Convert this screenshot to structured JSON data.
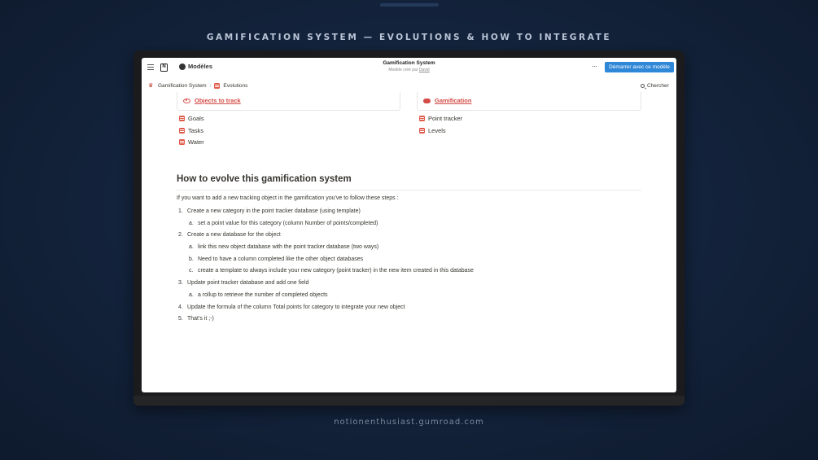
{
  "headline": "GAMIFICATION SYSTEM — EVOLUTIONS & HOW TO INTEGRATE",
  "footer": "notionenthusiast.gumroad.com",
  "topbar": {
    "templates_label": "Modèles",
    "page_title": "Gamification System",
    "subtitle_prefix": "Modèle créé par",
    "author": "David",
    "more_label": "···",
    "start_button": "Démarrer avec ce modèle"
  },
  "breadcrumb": {
    "root": "Gamification System",
    "separator": "/",
    "current": "Evolutions"
  },
  "search_label": "Chercher",
  "cards": {
    "left": {
      "title": "Objects to track",
      "icon": "eye-icon",
      "items": [
        "Goals",
        "Tasks",
        "Water"
      ]
    },
    "right": {
      "title": "Gamification",
      "icon": "gamepad-icon",
      "items": [
        "Point tracker",
        "Levels"
      ]
    }
  },
  "section": {
    "heading": "How to evolve this gamification system",
    "intro": "If you want to add a new tracking object in the gamification you've to follow these steps :",
    "steps": [
      {
        "num": "1.",
        "text": "Create a new category in the point tracker database (using template)",
        "level": 0
      },
      {
        "num": "a.",
        "text": "set a point value for this category  (column Number of points/completed)",
        "level": 1
      },
      {
        "num": "2.",
        "text": "Create a new database for the object",
        "level": 0
      },
      {
        "num": "a.",
        "text": "link this new object database with the point tracker database (two ways)",
        "level": 1
      },
      {
        "num": "b.",
        "text": "Need to have a column completed like the other object databases",
        "level": 1
      },
      {
        "num": "c.",
        "text": "create a template to always include your new category (point tracker) in the new item created in this database",
        "level": 1
      },
      {
        "num": "3.",
        "text": "Update point tracker database and add one field",
        "level": 0
      },
      {
        "num": "a.",
        "text": "a rollup to retrieve the number of completed objects",
        "level": 1
      },
      {
        "num": "4.",
        "text": "Update the formula of the column Total points for category to integrate your new object",
        "level": 0
      },
      {
        "num": "5.",
        "text": "That's it ;-)",
        "level": 0
      }
    ]
  },
  "colors": {
    "accent_red": "#d44c47",
    "button_blue": "#2f87d8",
    "background": "#14243d"
  }
}
